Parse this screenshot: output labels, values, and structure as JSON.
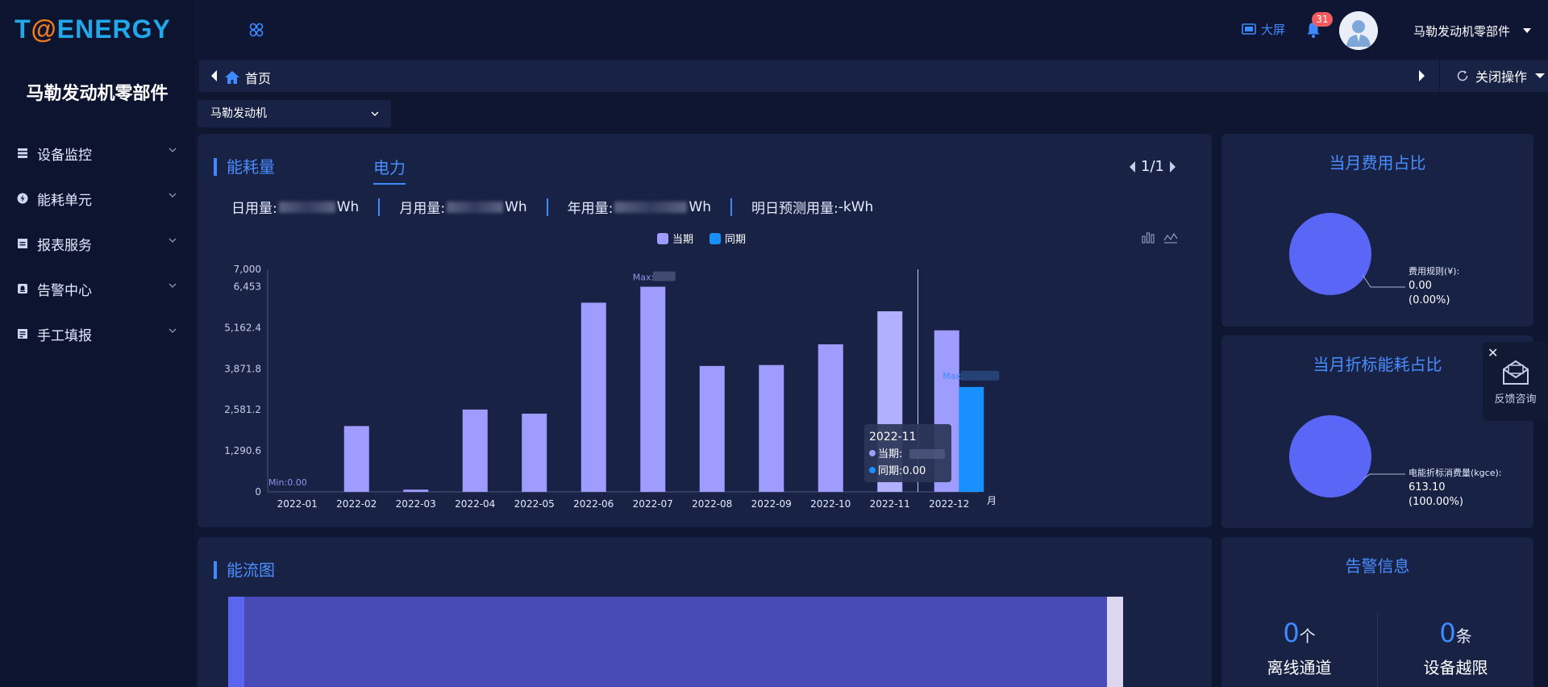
{
  "brand": {
    "logo_left": "T",
    "logo_at": "@",
    "logo_right": "ENERGY",
    "company": "马勒发动机零部件"
  },
  "sidebar": {
    "items": [
      {
        "label": "设备监控",
        "icon": "device-monitor-icon"
      },
      {
        "label": "能耗单元",
        "icon": "energy-unit-icon"
      },
      {
        "label": "报表服务",
        "icon": "report-icon"
      },
      {
        "label": "告警中心",
        "icon": "alarm-icon"
      },
      {
        "label": "手工填报",
        "icon": "manual-entry-icon"
      }
    ]
  },
  "header": {
    "bigscreen_label": "大屏",
    "notification_count": "31",
    "user_name": "马勒发动机零部件"
  },
  "breadcrumb": {
    "home_label": "首页",
    "close_ops_label": "关闭操作"
  },
  "selector": {
    "value": "马勒发动机"
  },
  "energy_panel": {
    "title": "能耗量",
    "tab": "电力",
    "pager": "1/1",
    "stats": {
      "daily_label": "日用量:",
      "daily_unit": "Wh",
      "monthly_label": "月用量:",
      "monthly_unit": "Wh",
      "yearly_label": "年用量:",
      "yearly_unit": "Wh",
      "forecast_label": "明日预测用量:",
      "forecast_value": "-kWh"
    }
  },
  "chart_data": {
    "type": "bar",
    "categories": [
      "2022-01",
      "2022-02",
      "2022-03",
      "2022-04",
      "2022-05",
      "2022-06",
      "2022-07",
      "2022-08",
      "2022-09",
      "2022-10",
      "2022-11",
      "2022-12"
    ],
    "series": [
      {
        "name": "当期",
        "values": [
          0,
          2070,
          70,
          2590,
          2460,
          5950,
          6453,
          3960,
          3990,
          4640,
          5680,
          5080
        ],
        "color": "#9e9cff"
      },
      {
        "name": "同期",
        "values": [
          0,
          0,
          0,
          0,
          0,
          0,
          0,
          0,
          0,
          0,
          0,
          3300
        ],
        "color": "#1890ff"
      }
    ],
    "y_ticks": [
      "0",
      "1,290.6",
      "2,581.2",
      "3,871.8",
      "5,162.4",
      "6,453",
      "7,000"
    ],
    "y_tick_values": [
      0,
      1290.6,
      2581.2,
      3871.8,
      5162.4,
      6453,
      7000
    ],
    "ylim": [
      0,
      7000
    ],
    "xlabel": "月",
    "annotations": {
      "min_label": "Min:0.00",
      "max_label_1": "Max:",
      "max_label_2": "Max:"
    },
    "tooltip": {
      "title": "2022-11",
      "current_label": "当期:",
      "last_label": "同期:0.00"
    },
    "legend_position": "top-center"
  },
  "flow_panel": {
    "title": "能流图"
  },
  "cost_panel": {
    "title": "当月费用占比",
    "label_name": "费用规则(¥):",
    "label_value": "0.00",
    "label_pct": "(0.00%)"
  },
  "fold_panel": {
    "title": "当月折标能耗占比",
    "label_name": "电能折标消费量(kgce):",
    "label_value": "613.10",
    "label_pct": "(100.00%)"
  },
  "alarm_panel": {
    "title": "告警信息",
    "offline_count": "0",
    "offline_unit": "个",
    "offline_label": "离线通道",
    "limit_count": "0",
    "limit_unit": "条",
    "limit_label": "设备越限"
  },
  "feedback": {
    "label": "反馈咨询",
    "close": "✕"
  },
  "colors": {
    "accent": "#3d8bff",
    "bar_current": "#9e9cff",
    "bar_last": "#1890ff",
    "pie": "#5a66f5",
    "panel": "#182244",
    "bg": "#0f1630"
  }
}
